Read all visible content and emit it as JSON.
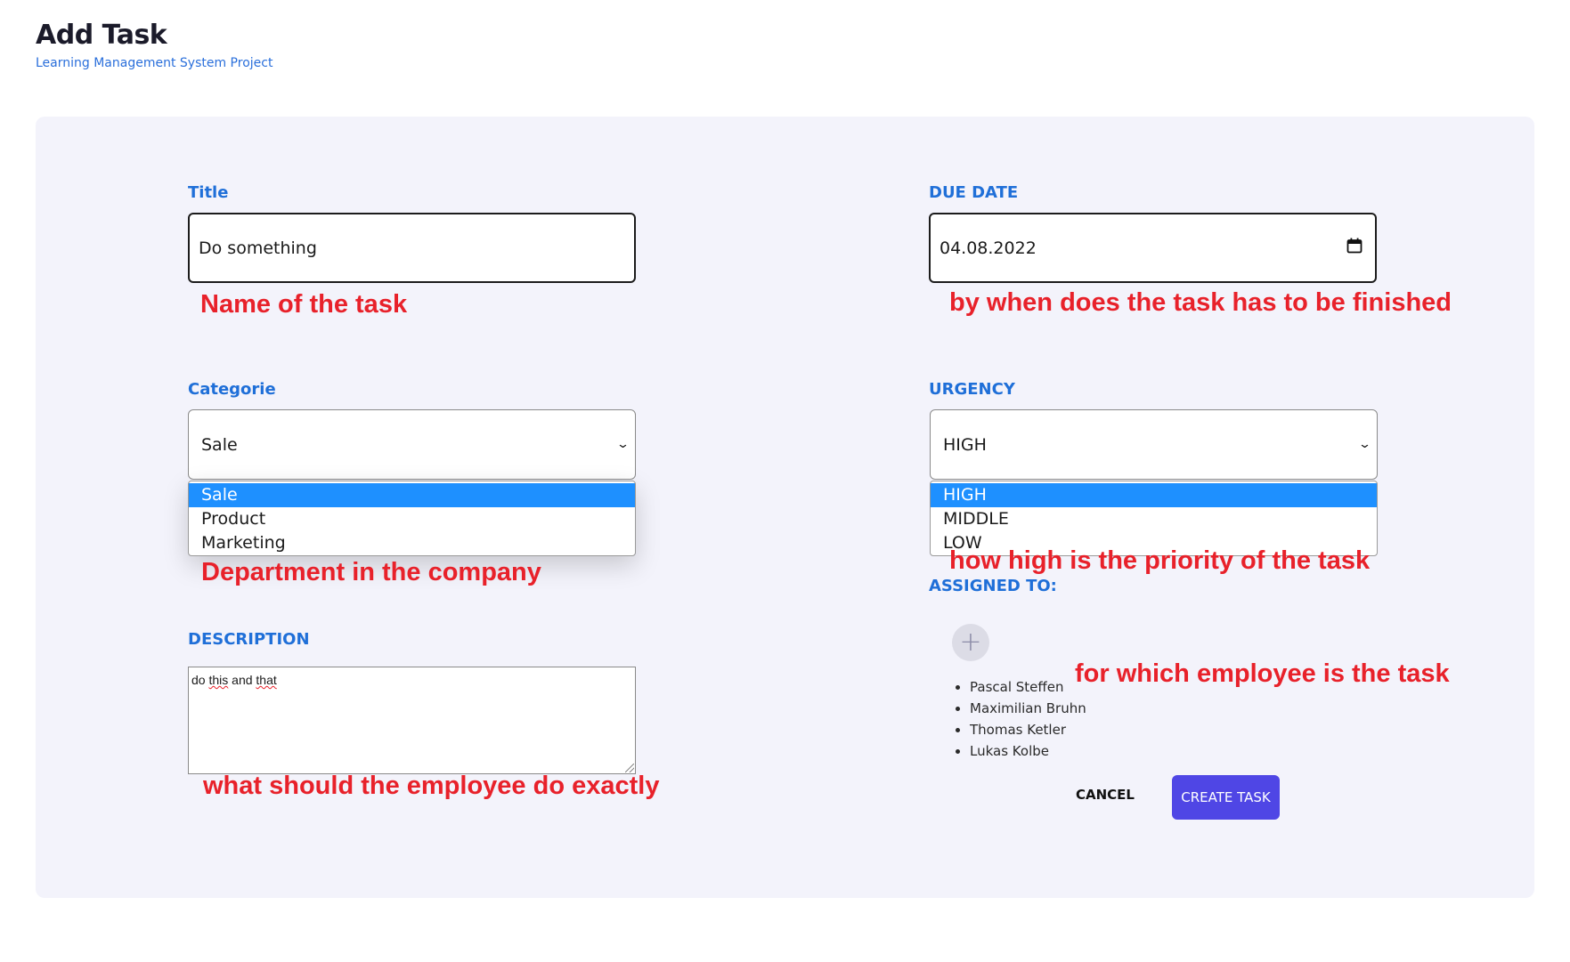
{
  "header": {
    "title": "Add Task",
    "subtitle": "Learning Management System Project"
  },
  "form": {
    "title": {
      "label": "Title",
      "value": "Do something",
      "annotation": "Name of the task"
    },
    "due_date": {
      "label": "DUE DATE",
      "value": "04.08.2022",
      "icon": "calendar-icon",
      "annotation": "by when does the task has to be finished"
    },
    "categorie": {
      "label": "Categorie",
      "selected": "Sale",
      "options": [
        "Sale",
        "Product",
        "Marketing"
      ],
      "annotation": "Department in the company"
    },
    "urgency": {
      "label": "URGENCY",
      "selected": "HIGH",
      "options": [
        "HIGH",
        "MIDDLE",
        "LOW"
      ],
      "annotation": "how high is the priority of the task"
    },
    "description": {
      "label": "DESCRIPTION",
      "value_parts": [
        "do ",
        "this",
        " and ",
        "that"
      ],
      "annotation": "what should the employee do exactly"
    },
    "assigned_to": {
      "label": "ASSIGNED TO:",
      "add_icon": "plus-icon",
      "people": [
        "Pascal Steffen",
        "Maximilian Bruhn",
        "Thomas Ketler",
        "Lukas Kolbe"
      ],
      "annotation": "for which employee is the task"
    },
    "actions": {
      "cancel_label": "CANCEL",
      "create_label": "CREATE TASK"
    }
  },
  "colors": {
    "accent_blue": "#1f6fd8",
    "annotation_red": "#e8212a",
    "primary_button": "#4f46e5",
    "card_background": "#f3f3fb",
    "selected_option": "#1e90ff"
  }
}
